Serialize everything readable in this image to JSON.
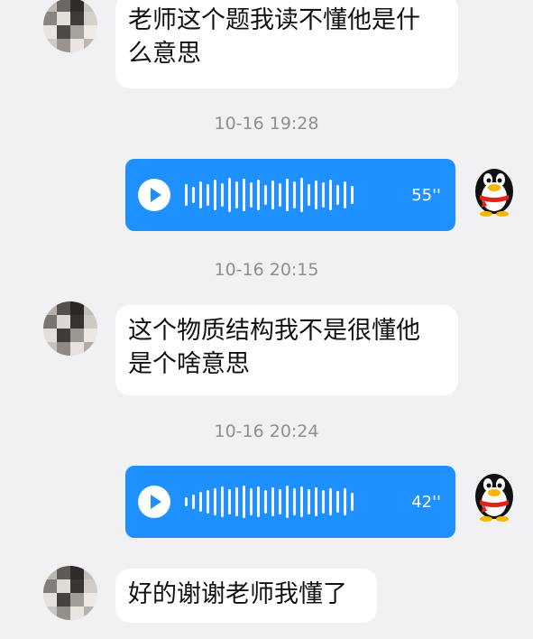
{
  "messages": [
    {
      "type": "incoming_text",
      "text_line1": "老师这个题我读不懂他是什",
      "text_line2": "么意思"
    },
    {
      "type": "timestamp",
      "text": "10-16 19:28"
    },
    {
      "type": "outgoing_voice",
      "duration": "55''"
    },
    {
      "type": "timestamp",
      "text": "10-16 20:15"
    },
    {
      "type": "incoming_text",
      "text_line1": "这个物质结构我不是很懂他",
      "text_line2": "是个啥意思"
    },
    {
      "type": "timestamp",
      "text": "10-16 20:24"
    },
    {
      "type": "outgoing_voice",
      "duration": "42''"
    },
    {
      "type": "incoming_text",
      "text_line1": "好的谢谢老师我懂了"
    }
  ],
  "colors": {
    "voice_bubble": "#1e90ff",
    "background": "#f1f1f3",
    "incoming_bubble": "#ffffff",
    "timestamp": "#8e8e93"
  },
  "icons": {
    "incoming_avatar": "pixelated-avatar",
    "outgoing_avatar": "qq-penguin-icon",
    "voice_play": "play-icon",
    "voice_wave": "waveform-icon"
  }
}
